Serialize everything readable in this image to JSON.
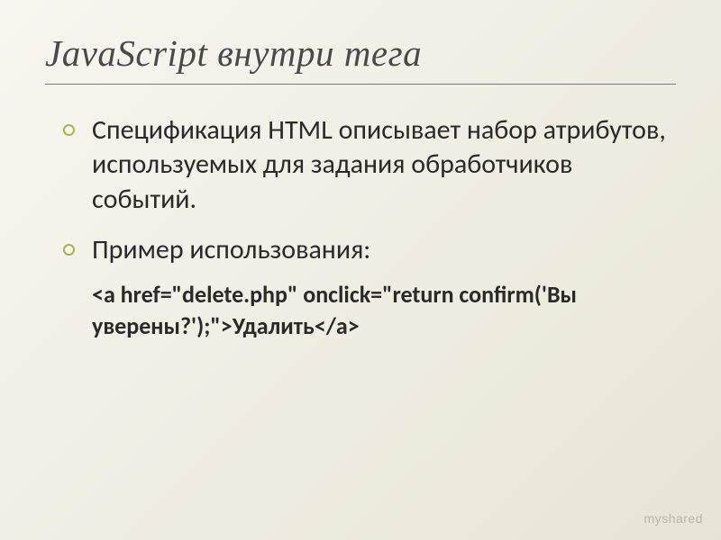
{
  "slide": {
    "title": "JavaScript внутри тега",
    "bullet1": "Спецификация HTML описывает набор атрибутов, используемых для задания обработчиков событий.",
    "bullet2": "Пример использования:",
    "code": "<a href=\"delete.php\" onclick=\"return confirm('Вы уверены?');\">Удалить</a>"
  },
  "watermark": {
    "part1": "my",
    "part2": "shared"
  }
}
